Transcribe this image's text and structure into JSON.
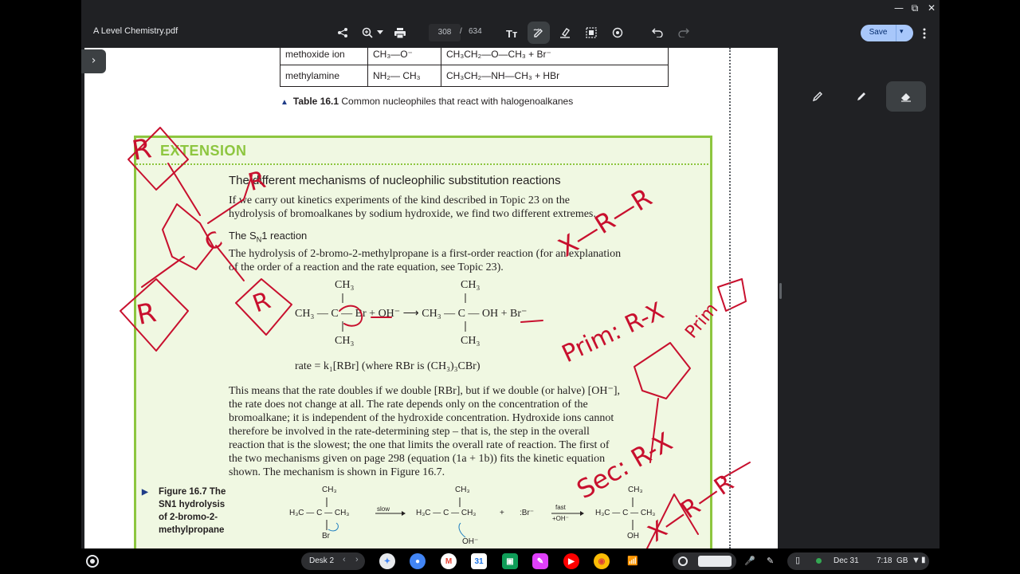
{
  "window": {
    "filename": "A Level Chemistry.pdf",
    "page_current": "308",
    "page_total": "634",
    "save_label": "Save",
    "controls": {
      "minimize": "—",
      "maximize": "⧉",
      "close": "✕"
    }
  },
  "table": {
    "rows": [
      {
        "name": "methoxide ion",
        "formula": "CH₃—O⁻",
        "product": "CH₃CH₂—O—CH₃ + Br⁻"
      },
      {
        "name": "methylamine",
        "formula": "NH₂— CH₃",
        "product": "CH₃CH₂—NH—CH₃ + HBr"
      }
    ],
    "caption_label": "Table 16.1",
    "caption_text": " Common nucleophiles that react with halogenoalkanes"
  },
  "extension": {
    "heading": "EXTENSION",
    "title": "The different mechanisms of nucleophilic substitution reactions",
    "intro_line1": "If we carry out kinetics experiments of the kind described in Topic 23 on the",
    "intro_line2": "hydrolysis of bromoalkanes by sodium hydroxide, we find two different extremes.",
    "sn1_heading_a": "The S",
    "sn1_heading_sub": "N",
    "sn1_heading_b": "1 reaction",
    "sn1_line1": "The hydrolysis of 2-bromo-2-methylpropane is a first-order reaction (for an explanation",
    "sn1_line2": "of the order of a reaction and the rate equation, see Topic 23).",
    "equation": {
      "top_ch3_left": "CH₃",
      "left": "CH₃ — C — Br + OH⁻ ⟶ CH₃ — C — OH + Br⁻",
      "bottom_ch3_left": "CH₃",
      "top_ch3_right": "CH₃",
      "bottom_ch3_right": "CH₃"
    },
    "rate_eq": "rate = k₁[RBr]     (where RBr is (CH₃)₃CBr)",
    "para": [
      "This means that the rate doubles if we double [RBr], but if we double (or halve) [OH⁻],",
      "the rate does not change at all. The rate depends only on the concentration of the",
      "bromoalkane; it is independent of the hydroxide concentration. Hydroxide ions cannot",
      "therefore be involved in the rate-determining step – that is, the step in the overall",
      "reaction that is the slowest; the one that limits the overall rate of reaction. The first of",
      "the two mechanisms given on page 298 (equation (1a + 1b)) fits the kinetic equation",
      "shown. The mechanism is shown in Figure 16.7."
    ],
    "figure_caption": [
      "Figure 16.7 The",
      "SN1 hydrolysis",
      "of 2-bromo-2-",
      "methylpropane"
    ],
    "mechanism": {
      "m1_top": "CH₃",
      "m1_mid": "H₃C — C — CH₃",
      "m1_bot": "Br",
      "slow": "slow",
      "m2_top": "CH₃",
      "m2_mid": "H₃C — C — CH₃",
      "plus": "+",
      "br_ion": ":Br⁻",
      "fast": "fast",
      "fast_sub": "+OH⁻",
      "oh_ion": "OH⁻",
      "m3_top": "CH₃",
      "m3_mid": "H₃C — C — CH₃",
      "m3_bot": "OH"
    }
  },
  "annotations": {
    "r_labels": [
      "R",
      "R",
      "R",
      "R"
    ],
    "center_c": "C",
    "scribble_1": "X—R—R",
    "prim": "Prim: R-X",
    "prim2": "Prim",
    "sec": "Sec: R-X",
    "x_r": "X—R—R",
    "ink_color": "#c8102e"
  },
  "shelf": {
    "desk_label": "Desk 2",
    "date": "Dec 31",
    "time": "7:18",
    "gb": "GB"
  }
}
